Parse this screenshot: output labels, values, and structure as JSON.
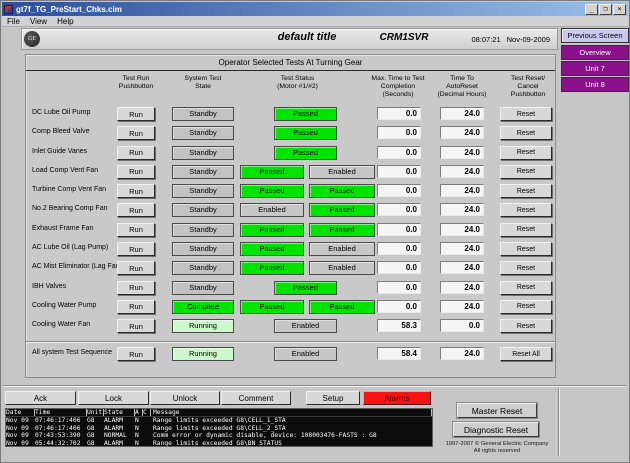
{
  "window": {
    "title": "gt7f_TG_PreStart_Chks.cim",
    "menus": [
      "File",
      "View",
      "Help"
    ],
    "minimize": "_",
    "maximize": "❐",
    "close": "×"
  },
  "header": {
    "title": "default title",
    "server": "CRM1SVR",
    "time": "08:07:21",
    "date": "Nov-09-2009"
  },
  "nav": {
    "items": [
      {
        "label": "Previous Screen",
        "style": "light"
      },
      {
        "label": "Overview",
        "style": "purple"
      },
      {
        "label": "Unit 7",
        "style": "purple"
      },
      {
        "label": "Unit 8",
        "style": "purple"
      }
    ]
  },
  "colors": {
    "passed_green": "#00e400",
    "running_palegreen": "#cdf8cd",
    "alarms_red": "#f71313",
    "nav_purple": "#8b108b"
  },
  "panel": {
    "title": "Operator Selected Tests At Turning Gear",
    "columns": [
      "Test Run\nPushbutton",
      "System Test\nState",
      "Test Status\n(Motor #1/#2)",
      "Max. Time to Test\nCompletion\n(Seconds)",
      "Time To\nAutoReset\n(Decimal Hours)",
      "Test Reset/\nCancel\nPushbutton"
    ],
    "run_label": "Run",
    "rows": [
      {
        "label": "DC Lube Oil Pump",
        "state": "Standby",
        "state_style": "flat",
        "status": [
          {
            "text": "Passed",
            "style": "green",
            "pos": "single"
          }
        ],
        "max": "0.0",
        "auto": "24.0",
        "reset": "Reset"
      },
      {
        "label": "Comp Bleed Valve",
        "state": "Standby",
        "state_style": "flat",
        "status": [
          {
            "text": "Passed",
            "style": "green",
            "pos": "single"
          }
        ],
        "max": "0.0",
        "auto": "24.0",
        "reset": "Reset"
      },
      {
        "label": "Inlet Guide Vanes",
        "state": "Standby",
        "state_style": "flat",
        "status": [
          {
            "text": "Passed",
            "style": "green",
            "pos": "single"
          }
        ],
        "max": "0.0",
        "auto": "24.0",
        "reset": "Reset"
      },
      {
        "label": "Load Comp Vent Fan",
        "state": "Standby",
        "state_style": "flat",
        "status": [
          {
            "text": "Passed",
            "style": "green",
            "pos": "left"
          },
          {
            "text": "Enabled",
            "style": "gray",
            "pos": "right"
          }
        ],
        "max": "0.0",
        "auto": "24.0",
        "reset": "Reset"
      },
      {
        "label": "Turbine Comp Vent Fan",
        "state": "Standby",
        "state_style": "flat",
        "status": [
          {
            "text": "Passed",
            "style": "green",
            "pos": "left"
          },
          {
            "text": "Passed",
            "style": "green",
            "pos": "right"
          }
        ],
        "max": "0.0",
        "auto": "24.0",
        "reset": "Reset"
      },
      {
        "label": "No.2 Bearing Comp Fan",
        "state": "Standby",
        "state_style": "flat",
        "status": [
          {
            "text": "Enabled",
            "style": "gray",
            "pos": "left"
          },
          {
            "text": "Passed",
            "style": "green",
            "pos": "right"
          }
        ],
        "max": "0.0",
        "auto": "24.0",
        "reset": "Reset"
      },
      {
        "label": "Exhaust Frame Fan",
        "state": "Standby",
        "state_style": "flat",
        "status": [
          {
            "text": "Passed",
            "style": "green",
            "pos": "left"
          },
          {
            "text": "Passed",
            "style": "green",
            "pos": "right"
          }
        ],
        "max": "0.0",
        "auto": "24.0",
        "reset": "Reset"
      },
      {
        "label": "AC Lube Oil (Lag Pump)",
        "state": "Standby",
        "state_style": "flat",
        "status": [
          {
            "text": "Passed",
            "style": "green",
            "pos": "left"
          },
          {
            "text": "Enabled",
            "style": "gray",
            "pos": "right"
          }
        ],
        "max": "0.0",
        "auto": "24.0",
        "reset": "Reset"
      },
      {
        "label": "AC Mist Eliminator (Lag Fan)",
        "state": "Standby",
        "state_style": "flat",
        "status": [
          {
            "text": "Passed",
            "style": "green",
            "pos": "left"
          },
          {
            "text": "Enabled",
            "style": "gray",
            "pos": "right"
          }
        ],
        "max": "0.0",
        "auto": "24.0",
        "reset": "Reset"
      },
      {
        "label": "IBH Valves",
        "state": "Standby",
        "state_style": "flat",
        "status": [
          {
            "text": "Passed",
            "style": "green",
            "pos": "single"
          }
        ],
        "max": "0.0",
        "auto": "24.0",
        "reset": "Reset"
      },
      {
        "label": "Cooling Water Pump",
        "state": "Complete",
        "state_style": "bright",
        "status": [
          {
            "text": "Passed",
            "style": "green",
            "pos": "left"
          },
          {
            "text": "Passed",
            "style": "green",
            "pos": "right"
          }
        ],
        "max": "0.0",
        "auto": "24.0",
        "reset": "Reset"
      },
      {
        "label": "Cooling Water Fan",
        "state": "Running",
        "state_style": "pale",
        "status": [
          {
            "text": "Enabled",
            "style": "gray",
            "pos": "single"
          }
        ],
        "max": "58.3",
        "auto": "0.0",
        "reset": "Reset"
      }
    ],
    "footer_row": {
      "label": "All system Test Sequence",
      "state": "Running",
      "state_style": "pale",
      "status": [
        {
          "text": "Enabled",
          "style": "gray",
          "pos": "single"
        }
      ],
      "max": "58.4",
      "auto": "24.0",
      "reset": "Reset All"
    }
  },
  "alarm_toolbar": {
    "buttons": [
      "Ack",
      "Lock",
      "Unlock",
      "Comment",
      "Setup"
    ],
    "alarms_label": "Alarms"
  },
  "alarm_table": {
    "headers": {
      "date": "Date",
      "time": "Time",
      "unit": "Unit",
      "state": "State",
      "a": "A",
      "c": "C",
      "message": "Message"
    },
    "rows": [
      {
        "date": "Nov 09",
        "time": "07:46:17:406",
        "unit": "G8",
        "state": "ALARM",
        "a": "N",
        "c": "",
        "message": "Range limits exceeded G8\\CELL_1_STA"
      },
      {
        "date": "Nov 09",
        "time": "07:46:17:406",
        "unit": "G8",
        "state": "ALARM",
        "a": "N",
        "c": "",
        "message": "Range limits exceeded G8\\CELL_2_STA"
      },
      {
        "date": "Nov 09",
        "time": "07:43:53:390",
        "unit": "G8",
        "state": "NORMAL",
        "a": "N",
        "c": "",
        "message": "Comm error or dynamic disable, device: 108003476-FASTS : G8"
      },
      {
        "date": "Nov 09",
        "time": "05:44:32:702",
        "unit": "G8",
        "state": "ALARM",
        "a": "N",
        "c": "",
        "message": "Range limits exceeded G8\\BN_STATUS"
      }
    ]
  },
  "footer": {
    "master_reset": "Master Reset",
    "diagnostic_reset": "Diagnostic Reset",
    "copyright_line1": "1997-2007 © General Electric Company",
    "copyright_line2": "All rights reserved"
  },
  "logo": "GE"
}
